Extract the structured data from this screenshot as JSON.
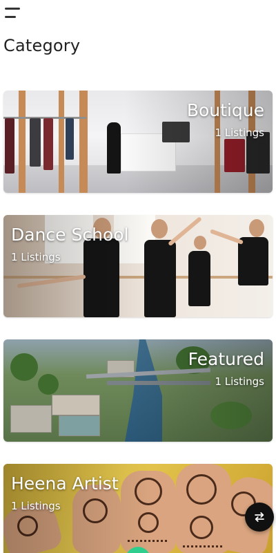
{
  "header": {
    "menu_icon": "hamburger-menu-icon"
  },
  "page": {
    "title": "Category"
  },
  "categories": [
    {
      "name": "Boutique",
      "count": "1 Listings",
      "align": "right"
    },
    {
      "name": "Dance School",
      "count": "1 Listings",
      "align": "left"
    },
    {
      "name": "Featured",
      "count": "1 Listings",
      "align": "right"
    },
    {
      "name": "Heena Artist",
      "count": "1 Listings",
      "align": "left"
    }
  ],
  "fab": {
    "icon": "swap-arrows-icon",
    "color": "#101010"
  },
  "accent": "#2ecf8e"
}
